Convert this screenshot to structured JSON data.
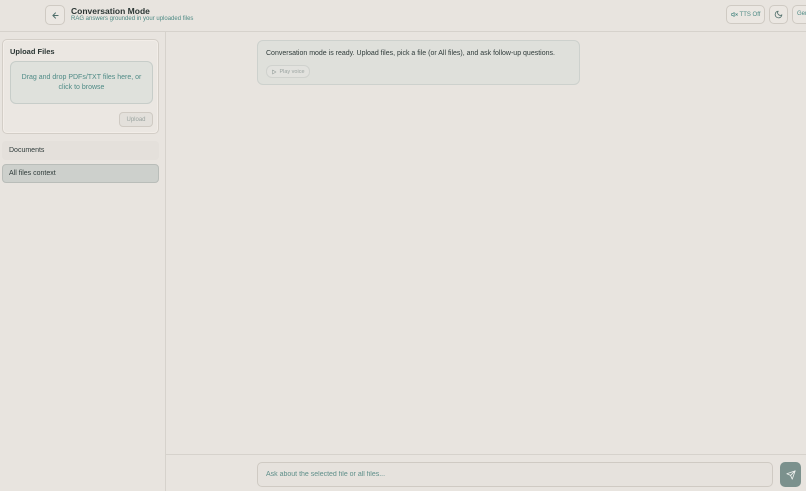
{
  "header": {
    "title": "Conversation Mode",
    "subtitle": "RAG answers grounded in your uploaded files",
    "back_icon": "arrow-left-icon",
    "tts_label": "TTS Off",
    "tts_icon": "speaker-icon",
    "theme_icon": "moon-icon",
    "gen_label": "Gen"
  },
  "sidebar": {
    "upload_title": "Upload Files",
    "dropzone_text": "Drag and drop PDFs/TXT files here, or click to browse",
    "upload_label": "Upload",
    "documents_label": "Documents",
    "all_files_label": "All files context"
  },
  "chat": {
    "messages": [
      {
        "text": "Conversation mode is ready. Upload files, pick a file (or All files), and ask follow-up questions.",
        "play_label": "Play voice"
      }
    ]
  },
  "composer": {
    "placeholder": "Ask about the selected file or all files...",
    "send_icon": "send-icon"
  },
  "colors": {
    "background": "#e8e4df",
    "accent": "#4f8b86",
    "send_button": "#7b918d"
  }
}
